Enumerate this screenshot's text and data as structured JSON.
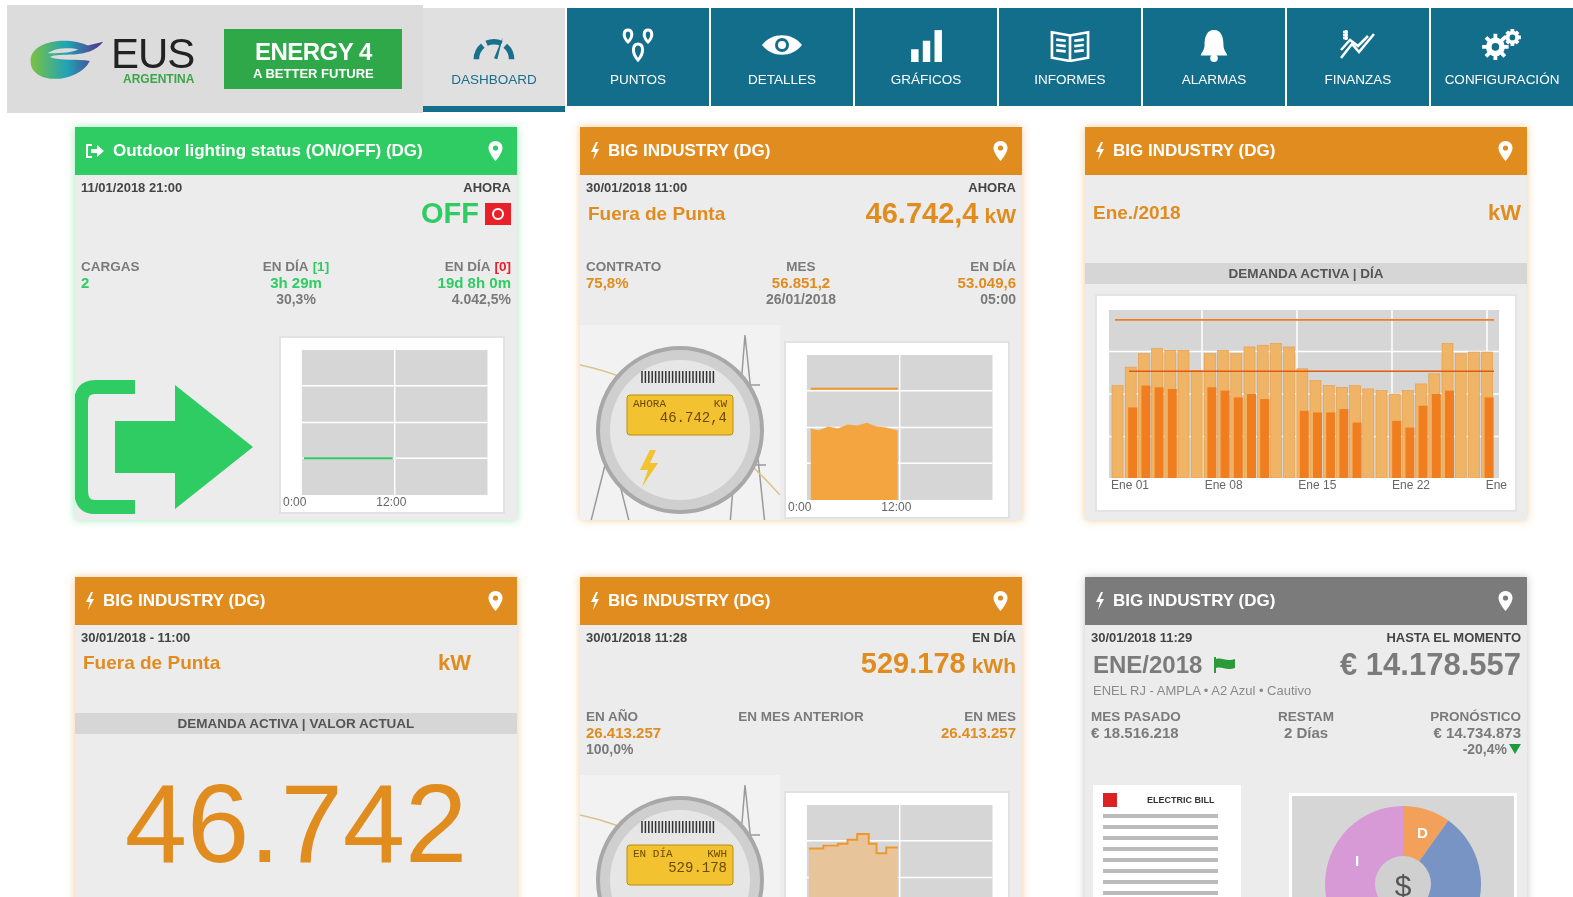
{
  "brand": {
    "name": "EUS",
    "subtitle": "ARGENTINA",
    "badge_line_1": "ENERGY 4",
    "badge_line_2": "A BETTER FUTURE"
  },
  "tabs": [
    {
      "label": "DASHBOARD",
      "selected": true
    },
    {
      "label": "PUNTOS",
      "selected": false
    },
    {
      "label": "DETALLES",
      "selected": false
    },
    {
      "label": "GRÁFICOS",
      "selected": false
    },
    {
      "label": "INFORMES",
      "selected": false
    },
    {
      "label": "ALARMAS",
      "selected": false
    },
    {
      "label": "FINANZAS",
      "selected": false
    },
    {
      "label": "CONFIGURACIÓN",
      "selected": false
    }
  ],
  "cards": [
    {
      "kind": "switch",
      "color": "#2ecc63",
      "title": "Outdoor lighting status (ON/OFF) (DG)",
      "timestamp": "11/01/2018 21:00",
      "now_label": "AHORA",
      "value": "OFF",
      "on": false,
      "stats": [
        {
          "label": "CARGAS",
          "value": "2"
        },
        {
          "label": "EN DÍA",
          "tag": {
            "text": "[1]",
            "color": "#2ecc63"
          },
          "value": "3h 29m",
          "sub": "30,3%"
        },
        {
          "label": "EN DÍA",
          "tag": {
            "text": "[0]",
            "color": "#e8202a"
          },
          "value": "19d 8h 0m",
          "sub": "4.042,5%"
        }
      ],
      "ticks": [
        "0:00",
        "12:00"
      ]
    },
    {
      "kind": "meter",
      "color": "#e08c1e",
      "title": "BIG INDUSTRY (DG)",
      "timestamp": "30/01/2018 11:00",
      "now_label": "AHORA",
      "period": "Fuera de Punta",
      "value": "46.742,4",
      "unit": "kW",
      "stats": [
        {
          "label": "CONTRATO",
          "value": "75,8%"
        },
        {
          "label": "MES",
          "value": "56.851,2",
          "sub": "26/01/2018"
        },
        {
          "label": "EN DÍA",
          "value": "53.049,6",
          "sub": "05:00"
        }
      ],
      "lcd": {
        "label": "AHORA",
        "unit": "KW",
        "value": "46.742,4"
      },
      "ticks": [
        "0:00",
        "12:00"
      ]
    },
    {
      "kind": "bars",
      "color": "#e08c1e",
      "title": "BIG INDUSTRY (DG)",
      "period": "Ene./2018",
      "unit": "kW",
      "section": "DEMANDA ACTIVA | DÍA",
      "ticks": [
        "Ene 01",
        "Ene 08",
        "Ene 15",
        "Ene 22",
        "Ene"
      ]
    },
    {
      "kind": "current",
      "color": "#e08c1e",
      "title": "BIG INDUSTRY (DG)",
      "timestamp": "30/01/2018 - 11:00",
      "period": "Fuera de Punta",
      "unit": "kW",
      "section": "DEMANDA ACTIVA | VALOR ACTUAL",
      "value": "46.742"
    },
    {
      "kind": "energy",
      "color": "#e08c1e",
      "title": "BIG INDUSTRY (DG)",
      "timestamp": "30/01/2018 11:28",
      "now_label": "EN DÍA",
      "value": "529.178",
      "unit": "kWh",
      "stats": [
        {
          "label": "EN AÑO",
          "value": "26.413.257",
          "sub": "100,0%"
        },
        {
          "label": "EN MES ANTERIOR"
        },
        {
          "label": "EN MES",
          "value": "26.413.257"
        }
      ],
      "lcd": {
        "label": "EN DÍA",
        "unit": "KWH",
        "value": "529.178"
      }
    },
    {
      "kind": "bill",
      "color": "#7b7b7b",
      "title": "BIG INDUSTRY (DG)",
      "timestamp": "30/01/2018 11:29",
      "now_label": "HASTA EL MOMENTO",
      "period": "ENE/2018",
      "value": "€ 14.178.557",
      "tariff": "ENEL RJ - AMPLA • A2 Azul • Cautivo",
      "stats": [
        {
          "label": "MES PASADO",
          "value": "€ 18.516.218"
        },
        {
          "label": "RESTAM",
          "value": "2 Días"
        },
        {
          "label": "PRONÓSTICO",
          "value": "€ 14.734.873",
          "sub": "-20,4%",
          "falling": true
        }
      ],
      "bill_heading": "ELECTRIC BILL",
      "donut_labels": [
        "D",
        "I",
        "$"
      ]
    }
  ]
}
